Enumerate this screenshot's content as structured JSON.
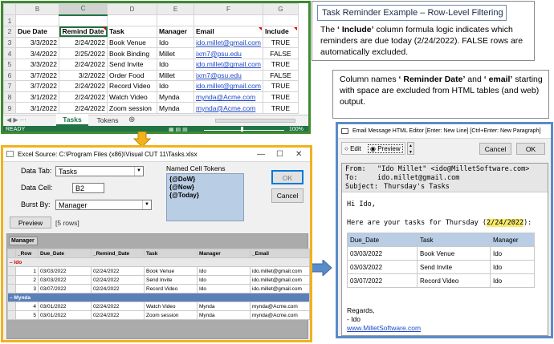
{
  "excel": {
    "col_headers": [
      "B",
      "C",
      "D",
      "E",
      "F",
      "G"
    ],
    "row_numbers": [
      "1",
      "2",
      "3",
      "4",
      "5",
      "6",
      "7",
      "8",
      "9"
    ],
    "headers": [
      "Due Date",
      "Remind Date",
      "Task",
      "Manager",
      "Email",
      "Include"
    ],
    "rows": [
      [
        "3/3/2022",
        "2/24/2022",
        "Book Venue",
        "Ido",
        "ido.millet@gmail.com",
        "TRUE"
      ],
      [
        "3/4/2022",
        "2/25/2022",
        "Book Binding",
        "Millet",
        "ixm7@psu.edu",
        "FALSE"
      ],
      [
        "3/3/2022",
        "2/24/2022",
        "Send Invite",
        "Ido",
        "ido.millet@gmail.com",
        "TRUE"
      ],
      [
        "3/7/2022",
        "3/2/2022",
        "Order Food",
        "Millet",
        "ixm7@psu.edu",
        "FALSE"
      ],
      [
        "3/7/2022",
        "2/24/2022",
        "Record Video",
        "Ido",
        "ido.millet@gmail.com",
        "TRUE"
      ],
      [
        "3/1/2022",
        "2/24/2022",
        "Watch Video",
        "Mynda",
        "mynda@Acme.com",
        "TRUE"
      ],
      [
        "3/1/2022",
        "2/24/2022",
        "Zoom session",
        "Mynda",
        "mynda@Acme.com",
        "TRUE"
      ]
    ],
    "tabs": [
      "Tasks",
      "Tokens"
    ],
    "add_sheet": "⊕",
    "status": "READY",
    "zoom": "100%"
  },
  "callout1": {
    "title": "Task Reminder Example – Row-Level Filtering",
    "text_prefix": "The ",
    "bold": "‘ Include’",
    "text_rest": " column formula logic indicates which reminders are due today (2/24/2022). FALSE rows are automatically excluded."
  },
  "callout2": {
    "p1": "Column names ",
    "b1": "‘ Reminder Date’",
    "p2": " and ",
    "b2": "‘ email’",
    "p3": " starting with space are excluded from HTML tables (and web) output."
  },
  "source_dialog": {
    "title": "Excel Source: C:\\Program Files (x86)\\Visual CUT 11\\Tasks.xlsx",
    "data_tab_label": "Data Tab:",
    "data_tab_value": "Tasks",
    "data_cell_label": "Data Cell:",
    "data_cell_value": "B2",
    "burst_label": "Burst By:",
    "burst_value": "Manager",
    "preview_button": "Preview",
    "rows_count": "[5 rows]",
    "tokens_label": "Named Cell Tokens",
    "tokens": [
      "{@DoW}",
      "{@Now}",
      "{@Today}"
    ],
    "ok_button": "OK",
    "cancel_button": "Cancel",
    "group_header": "Manager",
    "grid_headers": [
      "_Row",
      "Due_Date",
      "_Remind_Date",
      "Task",
      "Manager",
      "_Email"
    ],
    "groups": [
      {
        "name": "Ido",
        "rows": [
          [
            "1",
            "03/03/2022",
            "02/24/2022",
            "Book Venue",
            "Ido",
            "ido.millet@gmail.com"
          ],
          [
            "2",
            "03/03/2022",
            "02/24/2022",
            "Send Invite",
            "Ido",
            "ido.millet@gmail.com"
          ],
          [
            "3",
            "03/07/2022",
            "02/24/2022",
            "Record Video",
            "Ido",
            "ido.millet@gmail.com"
          ]
        ]
      },
      {
        "name": "Mynda",
        "rows": [
          [
            "4",
            "03/01/2022",
            "02/24/2022",
            "Watch Video",
            "Mynda",
            "mynda@Acme.com"
          ],
          [
            "5",
            "03/01/2022",
            "02/24/2022",
            "Zoom session",
            "Mynda",
            "mynda@Acme.com"
          ]
        ]
      }
    ]
  },
  "email_editor": {
    "title": "Email Message HTML Editor  [Enter: New Line]  [Ctrl+Enter: New Paragraph]",
    "edit_label": "Edit",
    "preview_label": "Preview",
    "cancel_button": "Cancel",
    "ok_button": "OK",
    "from_label": "From:",
    "from_value": "\"Ido Millet\" <ido@MilletSoftware.com>",
    "to_label": "To:",
    "to_value": "ido.millet@gmail.com",
    "subject_label": "Subject:",
    "subject_value": "Thursday's Tasks",
    "greeting": "Hi Ido,",
    "intro_prefix": "Here are your tasks for Thursday (",
    "intro_date": "2/24/2022",
    "intro_suffix": "):",
    "table_headers": [
      "Due_Date",
      "Task",
      "Manager"
    ],
    "table_rows": [
      [
        "03/03/2022",
        "Book Venue",
        "Ido"
      ],
      [
        "03/03/2022",
        "Send Invite",
        "Ido"
      ],
      [
        "03/07/2022",
        "Record Video",
        "Ido"
      ]
    ],
    "regards": "Regards,",
    "sign": "- Ido",
    "link": "www.MilletSoftware.com"
  },
  "colors": {
    "excel_border": "#3d8b2f",
    "source_border": "#f2b21c",
    "email_border": "#5b8bc9",
    "arrow_orange": "#f2b21c",
    "arrow_blue": "#5b8bc9"
  }
}
